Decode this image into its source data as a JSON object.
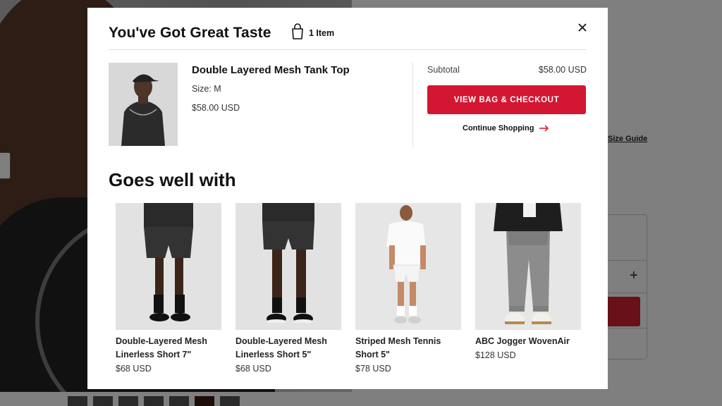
{
  "modal": {
    "title": "You've Got Great Taste",
    "item_count": "1 Item",
    "close_icon": "close-icon"
  },
  "cart_item": {
    "name": "Double Layered Mesh Tank Top",
    "size": "Size: M",
    "price": "$58.00 USD"
  },
  "summary": {
    "subtotal_label": "Subtotal",
    "subtotal_value": "$58.00 USD",
    "checkout_label": "VIEW BAG & CHECKOUT",
    "continue_label": "Continue Shopping",
    "accent_color": "#d31631"
  },
  "recommendations": {
    "title": "Goes well with",
    "items": [
      {
        "name": "Double-Layered Mesh Linerless Short 7\"",
        "price": "$68 USD"
      },
      {
        "name": "Double-Layered Mesh Linerless Short 5\"",
        "price": "$68 USD"
      },
      {
        "name": "Striped Mesh Tennis Short 5\"",
        "price": "$78 USD"
      },
      {
        "name": "ABC Jogger WovenAir",
        "price": "$128 USD"
      }
    ]
  },
  "background": {
    "size_guide": "Size Guide"
  }
}
